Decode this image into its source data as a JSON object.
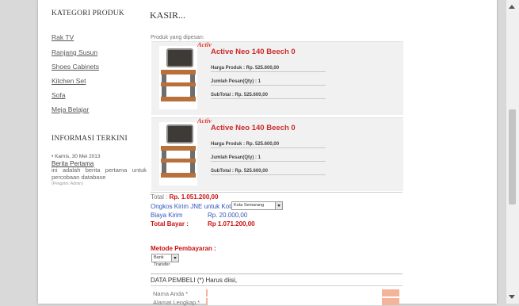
{
  "sidebar": {
    "category_title": "KATEGORI PRODUK",
    "categories": [
      "Rak TV",
      "Ranjang Susun",
      "Shoes Cabinets",
      "Kitchen Set",
      "Sofa",
      "Meja Belajar"
    ],
    "news_title": "INFORMASI TERKINI",
    "news": {
      "date": "• Kamis, 30 Mei 2013",
      "title": "Berita Pertama",
      "body": "ini adalah berita pertama untuk percobaan database",
      "meta": "(Pengirim: Admin)"
    }
  },
  "main": {
    "title": "KASIR...",
    "products_label": "Produk yang dipesan:",
    "brand_logo": "Activ",
    "products": [
      {
        "name": "Active Neo 140 Beech 0",
        "price": "Harga Produk : Rp. 525.600,00",
        "qty": "Jumlah Pesan(Qty) : 1",
        "subtotal": "SubTotal : Rp. 525.600,00"
      },
      {
        "name": "Active Neo 140 Beech 0",
        "price": "Harga Produk : Rp. 525.600,00",
        "qty": "Jumlah Pesan(Qty) : 1",
        "subtotal": "SubTotal : Rp. 525.600,00"
      }
    ],
    "total_label": "Total :",
    "total_value": "Rp. 1.051.200,00",
    "shipping_label": "Ongkos Kirim JNE untuk Kota :",
    "shipping_city": "Kota Semarang",
    "cost_label": "Biaya Kirim",
    "cost_value": "Rp. 20.000,00",
    "pay_label": "Total Bayar :",
    "pay_value": "Rp 1.071.200,00",
    "payment_method_label": "Metode Pembayaran :",
    "payment_method": "Bank Transfer",
    "buyer_title": "DATA PEMBELI (*) Harus diisi,",
    "fields": [
      {
        "label": "Nama Anda *"
      },
      {
        "label": "Alamat Lengkap *"
      }
    ]
  },
  "colors": {
    "accent_red": "#cc1111",
    "link_blue": "#3355bb",
    "required_field": "#f4b49a",
    "card_bg": "#f1f1f1"
  }
}
